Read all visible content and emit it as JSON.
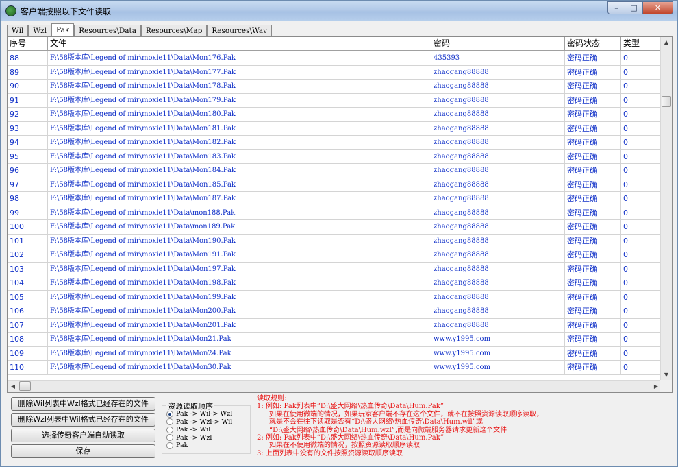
{
  "window": {
    "title": "客户端按照以下文件读取",
    "buttons": {
      "minimize": "–",
      "maximize": "□",
      "close": "✕"
    }
  },
  "tabs": [
    "Wil",
    "Wzl",
    "Pak",
    "Resources\\Data",
    "Resources\\Map",
    "Resources\\Wav"
  ],
  "active_tab": "Pak",
  "grid": {
    "headers": {
      "no": "序号",
      "file": "文件",
      "password": "密码",
      "status": "密码状态",
      "type": "类型"
    },
    "rows": [
      {
        "no": "88",
        "file": "F:\\58版本库\\Legend of mir\\moxie11\\Data\\Mon176.Pak",
        "password": "435393",
        "status": "密码正确",
        "type": "0"
      },
      {
        "no": "89",
        "file": "F:\\58版本库\\Legend of mir\\moxie11\\Data\\Mon177.Pak",
        "password": "zhaogang88888",
        "status": "密码正确",
        "type": "0"
      },
      {
        "no": "90",
        "file": "F:\\58版本库\\Legend of mir\\moxie11\\Data\\Mon178.Pak",
        "password": "zhaogang88888",
        "status": "密码正确",
        "type": "0"
      },
      {
        "no": "91",
        "file": "F:\\58版本库\\Legend of mir\\moxie11\\Data\\Mon179.Pak",
        "password": "zhaogang88888",
        "status": "密码正确",
        "type": "0"
      },
      {
        "no": "92",
        "file": "F:\\58版本库\\Legend of mir\\moxie11\\Data\\Mon180.Pak",
        "password": "zhaogang88888",
        "status": "密码正确",
        "type": "0"
      },
      {
        "no": "93",
        "file": "F:\\58版本库\\Legend of mir\\moxie11\\Data\\Mon181.Pak",
        "password": "zhaogang88888",
        "status": "密码正确",
        "type": "0"
      },
      {
        "no": "94",
        "file": "F:\\58版本库\\Legend of mir\\moxie11\\Data\\Mon182.Pak",
        "password": "zhaogang88888",
        "status": "密码正确",
        "type": "0"
      },
      {
        "no": "95",
        "file": "F:\\58版本库\\Legend of mir\\moxie11\\Data\\Mon183.Pak",
        "password": "zhaogang88888",
        "status": "密码正确",
        "type": "0"
      },
      {
        "no": "96",
        "file": "F:\\58版本库\\Legend of mir\\moxie11\\Data\\Mon184.Pak",
        "password": "zhaogang88888",
        "status": "密码正确",
        "type": "0"
      },
      {
        "no": "97",
        "file": "F:\\58版本库\\Legend of mir\\moxie11\\Data\\Mon185.Pak",
        "password": "zhaogang88888",
        "status": "密码正确",
        "type": "0"
      },
      {
        "no": "98",
        "file": "F:\\58版本库\\Legend of mir\\moxie11\\Data\\Mon187.Pak",
        "password": "zhaogang88888",
        "status": "密码正确",
        "type": "0"
      },
      {
        "no": "99",
        "file": "F:\\58版本库\\Legend of mir\\moxie11\\Data\\mon188.Pak",
        "password": "zhaogang88888",
        "status": "密码正确",
        "type": "0"
      },
      {
        "no": "100",
        "file": "F:\\58版本库\\Legend of mir\\moxie11\\Data\\mon189.Pak",
        "password": "zhaogang88888",
        "status": "密码正确",
        "type": "0"
      },
      {
        "no": "101",
        "file": "F:\\58版本库\\Legend of mir\\moxie11\\Data\\Mon190.Pak",
        "password": "zhaogang88888",
        "status": "密码正确",
        "type": "0"
      },
      {
        "no": "102",
        "file": "F:\\58版本库\\Legend of mir\\moxie11\\Data\\Mon191.Pak",
        "password": "zhaogang88888",
        "status": "密码正确",
        "type": "0"
      },
      {
        "no": "103",
        "file": "F:\\58版本库\\Legend of mir\\moxie11\\Data\\Mon197.Pak",
        "password": "zhaogang88888",
        "status": "密码正确",
        "type": "0"
      },
      {
        "no": "104",
        "file": "F:\\58版本库\\Legend of mir\\moxie11\\Data\\Mon198.Pak",
        "password": "zhaogang88888",
        "status": "密码正确",
        "type": "0"
      },
      {
        "no": "105",
        "file": "F:\\58版本库\\Legend of mir\\moxie11\\Data\\Mon199.Pak",
        "password": "zhaogang88888",
        "status": "密码正确",
        "type": "0"
      },
      {
        "no": "106",
        "file": "F:\\58版本库\\Legend of mir\\moxie11\\Data\\Mon200.Pak",
        "password": "zhaogang88888",
        "status": "密码正确",
        "type": "0"
      },
      {
        "no": "107",
        "file": "F:\\58版本库\\Legend of mir\\moxie11\\Data\\Mon201.Pak",
        "password": "zhaogang88888",
        "status": "密码正确",
        "type": "0"
      },
      {
        "no": "108",
        "file": "F:\\58版本库\\Legend of mir\\moxie11\\Data\\Mon21.Pak",
        "password": "www.y1995.com",
        "status": "密码正确",
        "type": "0"
      },
      {
        "no": "109",
        "file": "F:\\58版本库\\Legend of mir\\moxie11\\Data\\Mon24.Pak",
        "password": "www.y1995.com",
        "status": "密码正确",
        "type": "0"
      },
      {
        "no": "110",
        "file": "F:\\58版本库\\Legend of mir\\moxie11\\Data\\Mon30.Pak",
        "password": "www.y1995.com",
        "status": "密码正确",
        "type": "0"
      }
    ]
  },
  "controls": {
    "btn_delete_wil_wzl": "删除Wil列表中Wzl格式已经存在的文件",
    "btn_delete_wzl_wil": "删除Wzl列表中Wil格式已经存在的文件",
    "btn_select_client": "选择传奇客户端自动读取",
    "btn_save": "保存",
    "order_group_title": "资源读取顺序",
    "order_options": [
      "Pak -> Wil-> Wzl",
      "Pak -> Wzl-> Wil",
      "Pak -> Wil",
      "Pak -> Wzl",
      "Pak"
    ],
    "order_selected": 0
  },
  "rules": {
    "title": "读取规则:",
    "lines": [
      "1: 例如: Pak列表中“D:\\盛大网络\\热血传奇\\Data\\Hum.Pak”",
      "如果在使用微端的情况，如果玩家客户端不存在这个文件，就不在按照资源读取顺序读取，",
      "就是不会在往下读取是否有“D:\\盛大网络\\热血传奇\\Data\\Hum.wil”或",
      "“D:\\盛大网络\\热血传奇\\Data\\Hum.wzl”,而是向微端服务器请求更新这个文件",
      "2: 例如: Pak列表中“D:\\盛大网络\\热血传奇\\Data\\Hum.Pak”",
      "如果在不使用微端的情况，按照资源读取顺序读取",
      "3: 上面列表中没有的文件按照资源读取顺序读取"
    ]
  },
  "colors": {
    "row_text": "#1030c8",
    "rules_text": "#e81414"
  }
}
